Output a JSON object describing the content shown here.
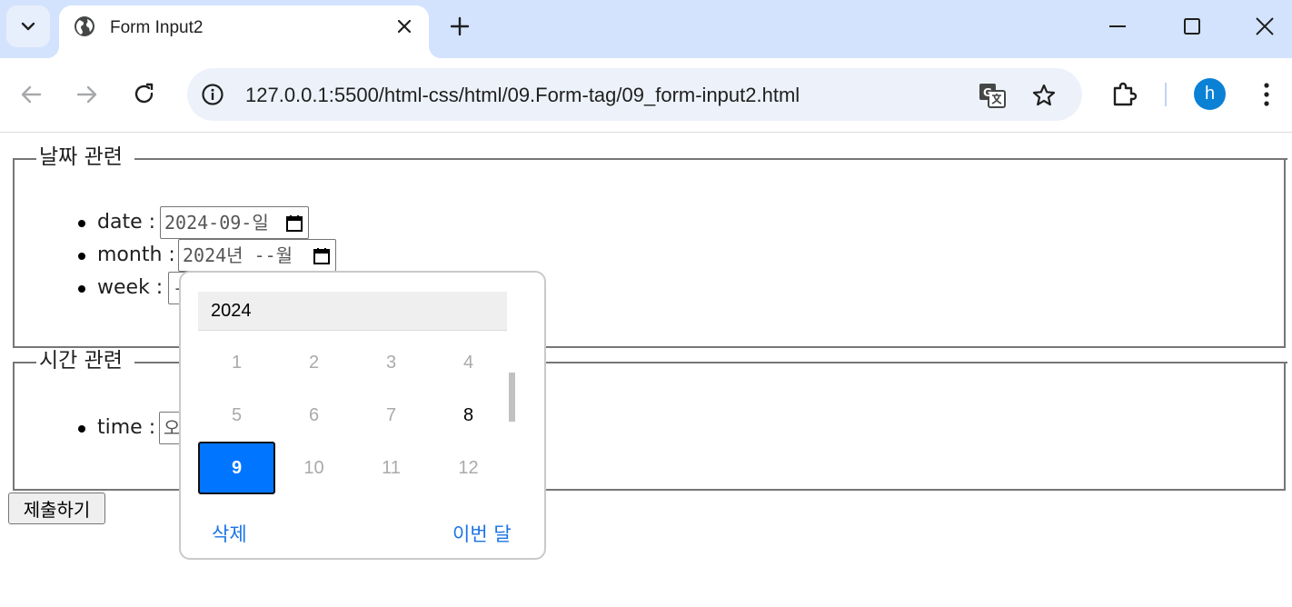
{
  "browser": {
    "tab_title": "Form Input2",
    "url": "127.0.0.1:5500/html-css/html/09.Form-tag/09_form-input2.html",
    "profile_initial": "h"
  },
  "form": {
    "date_section": {
      "legend": "날짜 관련",
      "items": [
        {
          "label": "date : ",
          "value": "2024-09-일"
        },
        {
          "label": "month : ",
          "value": "2024년 --월"
        },
        {
          "label": "week : ",
          "value": "-"
        }
      ]
    },
    "time_section": {
      "legend": "시간 관련",
      "items": [
        {
          "label": "time : ",
          "value": "오"
        }
      ]
    },
    "submit_label": "제출하기"
  },
  "month_picker": {
    "year": "2024",
    "months": [
      "1",
      "2",
      "3",
      "4",
      "5",
      "6",
      "7",
      "8",
      "9",
      "10",
      "11",
      "12"
    ],
    "enabled_months": [
      "8",
      "9"
    ],
    "selected_month": "9",
    "clear_label": "삭제",
    "this_month_label": "이번 달",
    "accent_color": "#0075ff",
    "link_color": "#1a73e8"
  }
}
